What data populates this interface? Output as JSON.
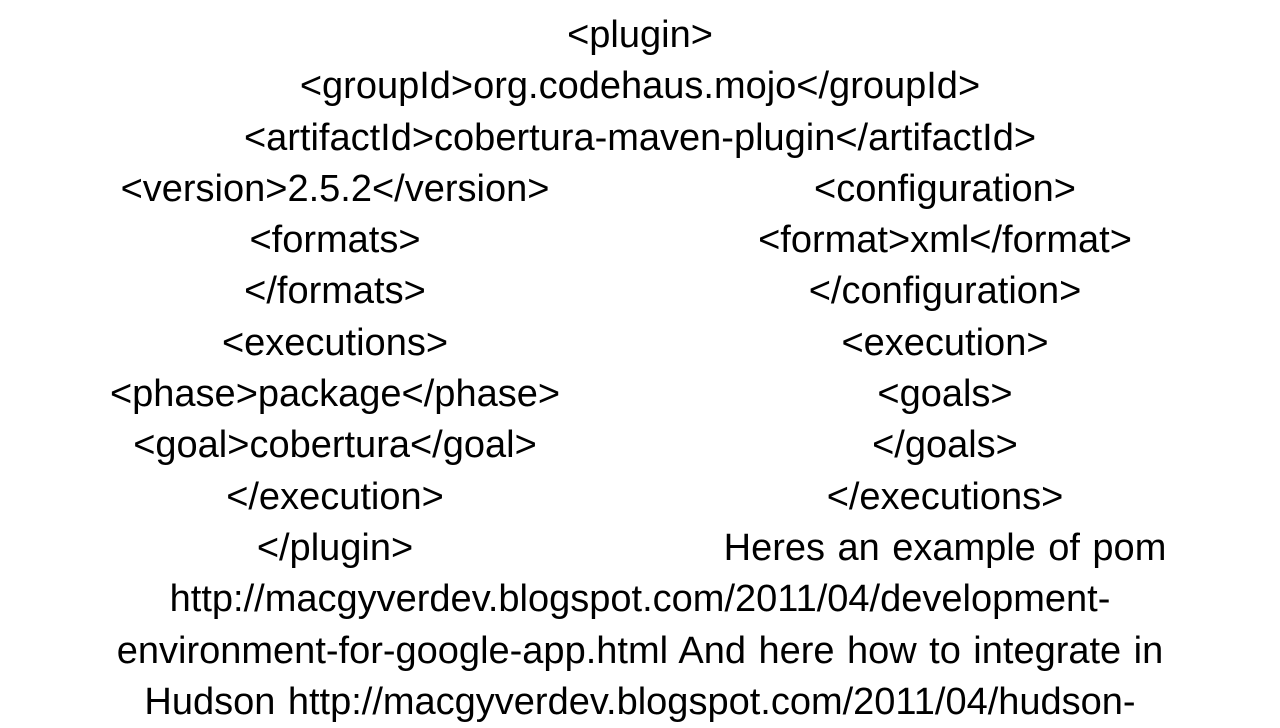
{
  "lines": {
    "l1": "<plugin>",
    "l2": "<groupId>org.codehaus.mojo</groupId>",
    "l3": "<artifactId>cobertura-maven-plugin</artifactId>",
    "l4a": "<version>2.5.2</version>",
    "l4b": "<configuration>",
    "l5a": "<formats>",
    "l5b": "<format>xml</format>",
    "l6a": "</formats>",
    "l6b": "</configuration>",
    "l7a": "<executions>",
    "l7b": "<execution>",
    "l8a": "<phase>package</phase>",
    "l8b": "<goals>",
    "l9a": "<goal>cobertura</goal>",
    "l9b": "</goals>",
    "l10a": "</execution>",
    "l10b": "</executions>",
    "l11a": "</plugin>",
    "l11b": "Heres an example of pom",
    "l12": "http://macgyverdev.blogspot.com/2011/04/development-",
    "l13": "environment-for-google-app.html And here how to integrate in",
    "l14": "Hudson http://macgyverdev.blogspot.com/2011/04/hudson-"
  }
}
